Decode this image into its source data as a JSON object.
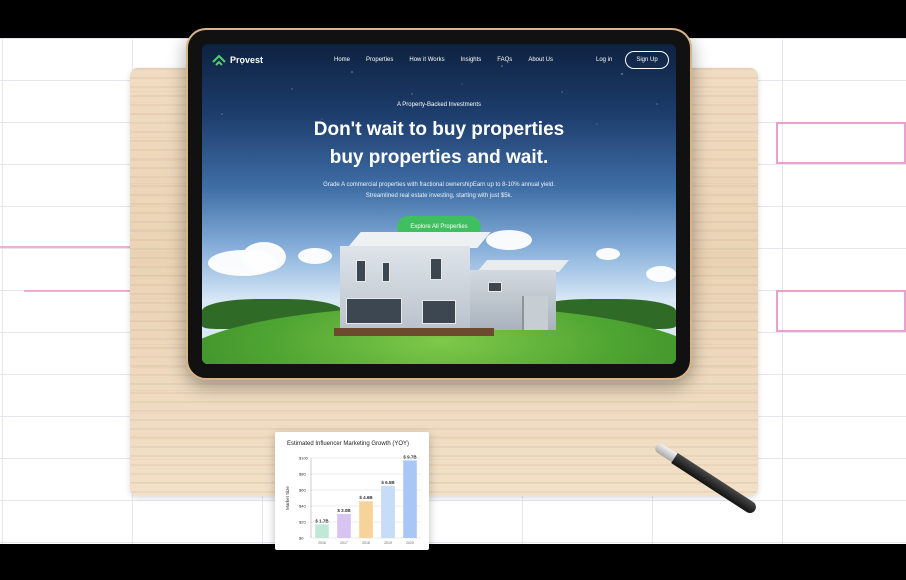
{
  "site": {
    "logo_text": "Provest",
    "nav": [
      "Home",
      "Properties",
      "How it Works",
      "Insights",
      "FAQs",
      "About Us"
    ],
    "login": "Log in",
    "signup": "Sign Up"
  },
  "hero": {
    "eyebrow": "A Property-Backed Investments",
    "headline_line1": "Don't wait to buy properties",
    "headline_line2": "buy properties and wait.",
    "subtext": "Grade A commercial properties with fractional ownershipEarn up to 8-10% annual yield. Streamlined real estate investing, starting with just $5k.",
    "cta": "Explore All Properties"
  },
  "colors": {
    "accent_green": "#3fbf5f",
    "wood": "#ead3b5",
    "bezel_gold": "#d9b487",
    "pink_grid": "#e88fc8"
  },
  "icons": [
    "provest-logo-icon"
  ],
  "chart_data": {
    "type": "bar",
    "title": "Estimated Influencer Marketing Growth (YOY)",
    "ylabel": "Market Size",
    "xlabel": "",
    "categories": [
      "2016",
      "2017",
      "2018",
      "2019",
      "2020"
    ],
    "values": [
      1.7,
      3.0,
      4.6,
      6.5,
      9.7
    ],
    "data_labels": [
      "$ 1.7B",
      "$ 3.0B",
      "$ 4.6B",
      "$ 6.5B",
      "$ 9.7B"
    ],
    "yticks": [
      0,
      2,
      4,
      6,
      8,
      10
    ],
    "ytick_labels": [
      "$0",
      "$20",
      "$40",
      "$60",
      "$80",
      "$100"
    ],
    "ylim": [
      0,
      10
    ],
    "bar_colors": [
      "#bfe9d6",
      "#d8c4f2",
      "#f7d39a",
      "#c7dcf7",
      "#a9c7f5"
    ],
    "grid": true
  }
}
